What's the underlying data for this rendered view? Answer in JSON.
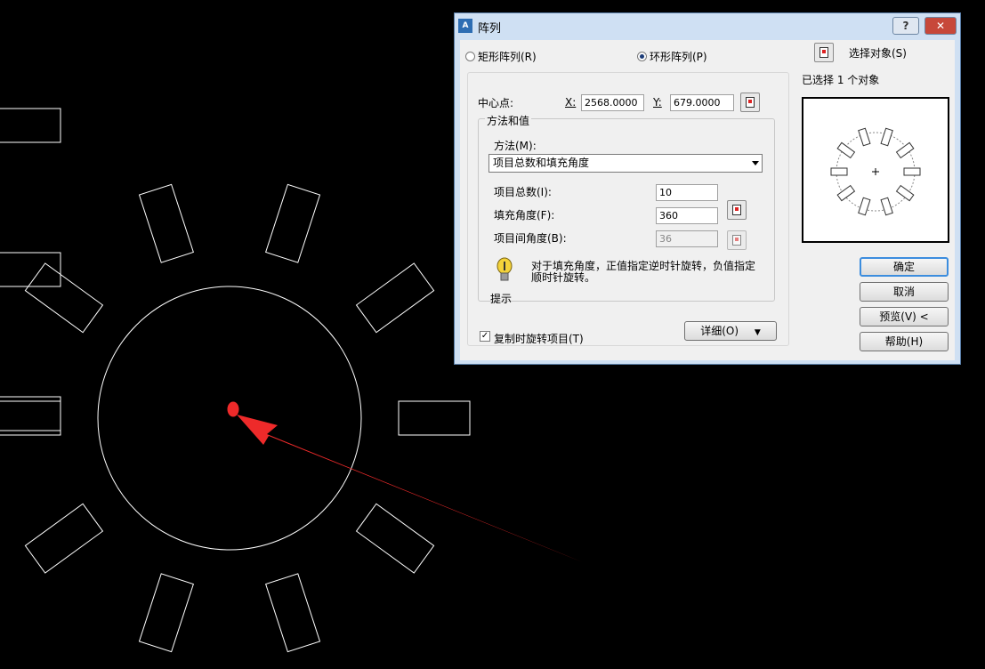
{
  "dialog": {
    "title": "阵列",
    "icon_name": "autocad-app-icon",
    "help_button": "?",
    "close_button": "✕"
  },
  "array_type": {
    "rect_label": "矩形阵列(R)",
    "polar_label": "环形阵列(P)",
    "selected": "polar"
  },
  "center": {
    "label": "中心点:",
    "x_label": "X:",
    "x_value": "2568.0000",
    "y_label": "Y:",
    "y_value": "679.0000"
  },
  "method_group": {
    "title": "方法和值",
    "method_label": "方法(M):",
    "method_value": "项目总数和填充角度",
    "total_label": "项目总数(I):",
    "total_value": "10",
    "fill_label": "填充角度(F):",
    "fill_value": "360",
    "between_label": "项目间角度(B):",
    "between_value": "36",
    "hint_label": "提示",
    "hint_text": "对于填充角度，正值指定逆时针旋转，负值指定顺时针旋转。"
  },
  "rotate_checkbox": {
    "label": "复制时旋转项目(T)",
    "checked": true
  },
  "details_button": {
    "label": "详细(O)",
    "icon": "▼"
  },
  "select_objects": {
    "label": "选择对象(S)",
    "status": "已选择 1 个对象"
  },
  "buttons": {
    "ok": "确定",
    "cancel": "取消",
    "preview": "预览(V) <",
    "help": "帮助(H)"
  },
  "colors": {
    "canvas_background": "#000000",
    "canvas_lines": "#ffffff",
    "annotation_red": "#ee2a2a",
    "dialog_frame": "#cfe0f3",
    "default_button_border": "#3c8dde"
  }
}
